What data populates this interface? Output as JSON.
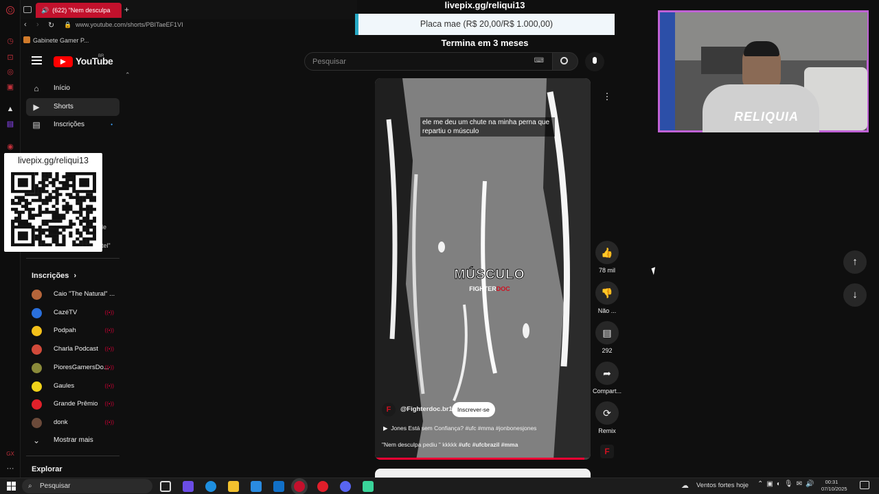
{
  "browser": {
    "tab_title": "(622) \"Nem desculpa",
    "url": "www.youtube.com/shorts/PBITaeEF1VI",
    "bookmark": "Gabinete Gamer P..."
  },
  "overlay": {
    "top_link": "livepix.gg/reliqui13",
    "donation_goal": "Placa mae (R$ 20,00/R$ 1.000,00)",
    "goal_deadline": "Termina em 3 meses",
    "qr_link": "livepix.gg/reliqui13",
    "webcam_text": "RELIQUIA"
  },
  "youtube": {
    "logo_text": "YouTube",
    "region": "BR",
    "search_placeholder": "Pesquisar"
  },
  "sidebar": {
    "items": [
      {
        "label": "Início",
        "icon": "home-icon"
      },
      {
        "label": "Shorts",
        "icon": "shorts-icon"
      },
      {
        "label": "Inscrições",
        "icon": "subscriptions-icon"
      }
    ],
    "partial_1": "le",
    "partial_2": "tel\"",
    "subs_header": "Inscrições",
    "subscriptions": [
      {
        "name": "Caio \"The Natural\" ...",
        "color": "#b5653a",
        "live": false
      },
      {
        "name": "CazéTV",
        "color": "#2a6fdb",
        "live": true
      },
      {
        "name": "Podpah",
        "color": "#f3c01a",
        "live": true
      },
      {
        "name": "Charla Podcast",
        "color": "#d14a3a",
        "live": true
      },
      {
        "name": "PioresGamersDo...",
        "color": "#8a8a3a",
        "live": true
      },
      {
        "name": "Gaules",
        "color": "#f0d21a",
        "live": true
      },
      {
        "name": "Grande Prêmio",
        "color": "#e0202a",
        "live": true
      },
      {
        "name": "donk",
        "color": "#6b4a3a",
        "live": true
      }
    ],
    "show_more": "Mostrar mais",
    "explore": "Explorar"
  },
  "video": {
    "caption": "ele me deu um chute na minha perna que repartiu o músculo",
    "center_title": "MÚSCULO",
    "watermark_a": "FIGHTER",
    "watermark_b": "DOC",
    "channel": "@Fighterdoc.br1",
    "subscribe": "Inscrever-se",
    "playlist": "Jones Está sem Confiança? #ufc #mma #jonbonesjones",
    "description": "\"Nem desculpa pediu \" kkkkk",
    "hashtags": "#ufc #ufcbrazil #mma",
    "progress": 0.97
  },
  "actions": {
    "likes": "78 mil",
    "dislike": "Não ...",
    "comments": "292",
    "share": "Compart...",
    "remix": "Remix"
  },
  "taskbar": {
    "search_placeholder": "Pesquisar",
    "weather": "Ventos fortes hoje",
    "time": "00:31",
    "date": "07/10/2025"
  },
  "colors": {
    "accent_red": "#ff0000",
    "webcam_border": "#c062d6",
    "progress": "#ff0033"
  }
}
